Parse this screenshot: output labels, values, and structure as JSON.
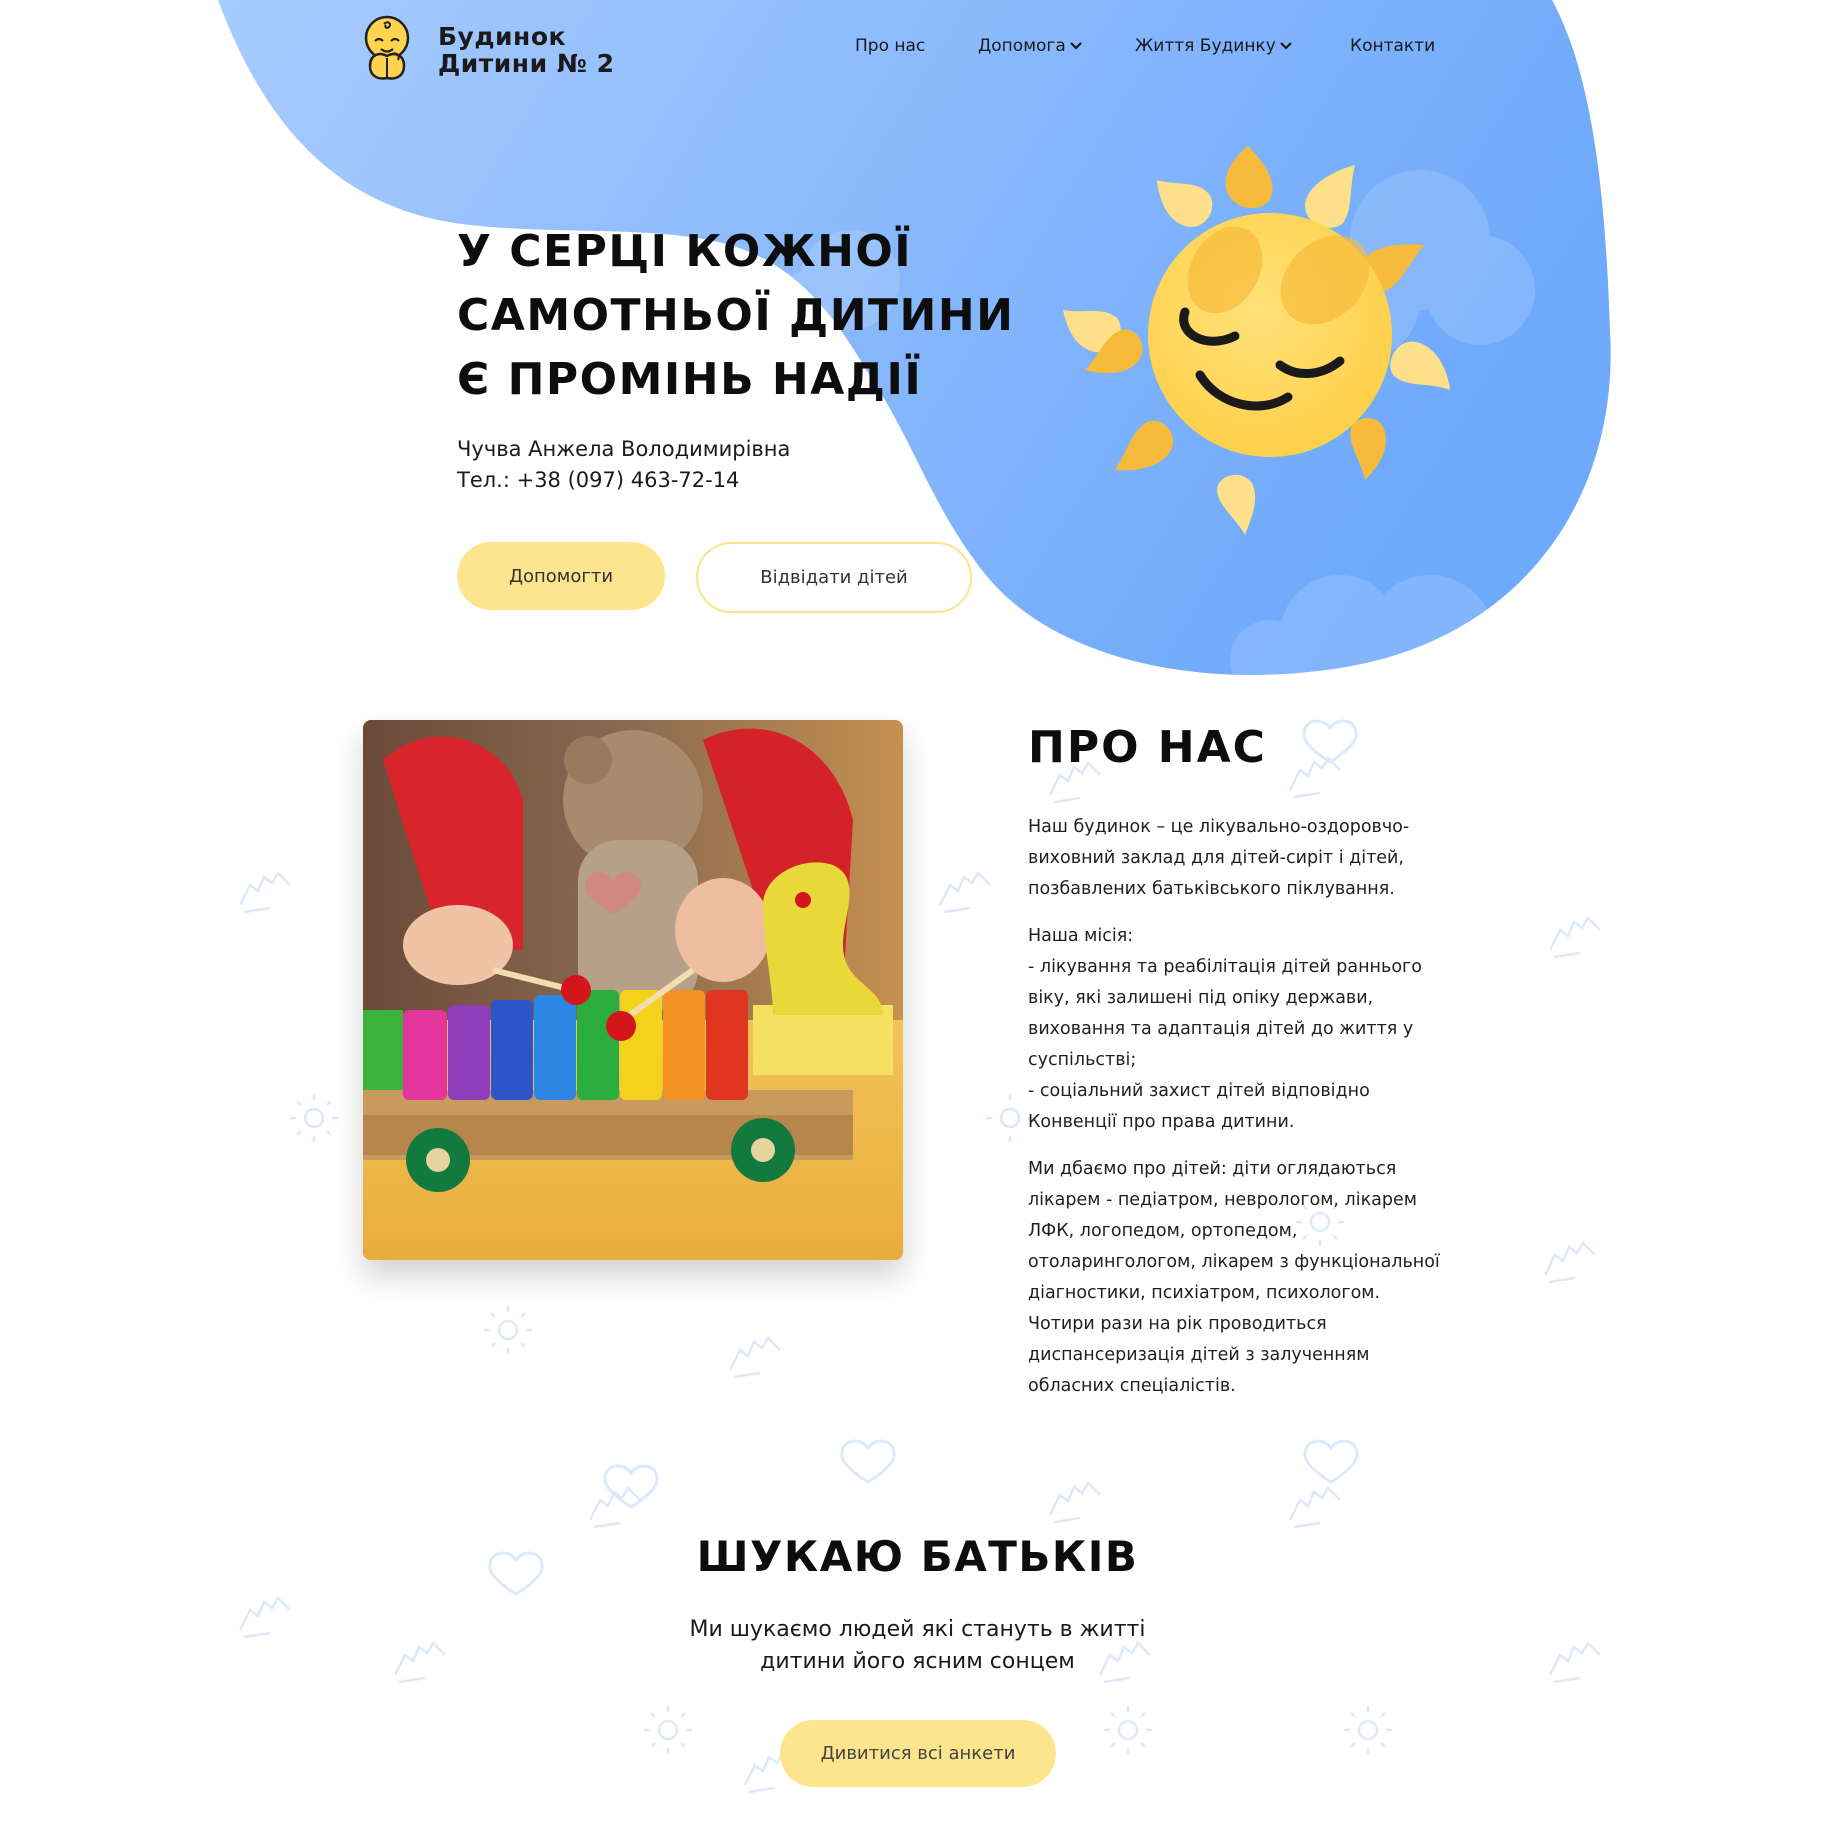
{
  "header": {
    "logo_line1": "Будинок",
    "logo_line2": "Дитини № 2",
    "nav": [
      {
        "label": "Про нас",
        "dropdown": false
      },
      {
        "label": "Допомога",
        "dropdown": true
      },
      {
        "label": "Життя Будинку",
        "dropdown": true
      },
      {
        "label": "Контакти",
        "dropdown": false
      }
    ]
  },
  "hero": {
    "title_lines": [
      "У СЕРЦІ КОЖНОЇ",
      "САМОТНЬОЇ ДИТИНИ",
      "Є ПРОМІНЬ НАДІЇ"
    ],
    "contact_name": "Чучва Анжела Володимирівна",
    "contact_phone": "Тел.: +38 (097) 463-72-14",
    "btn_help": "Допомогти",
    "btn_visit": "Відвідати дітей"
  },
  "about": {
    "title": "ПРО НАС",
    "p1": "Наш будинок – це лікувально-оздоровчо-\nвиховний заклад для дітей-сиріт і дітей,\nпозбавлених батьківського піклування.",
    "p2": "Наша місія:\n- лікування та реабілітація дітей раннього\nвіку, які залишені під опіку держави,\nвиховання та адаптація дітей до життя у\nсуспільстві;\n- соціальний захист дітей відповідно\nКонвенції про права дитини.",
    "p3": "Ми дбаємо про дітей: діти оглядаються\nлікарем - педіатром, неврологом, лікарем\nЛФК, логопедом, ортопедом,\nотоларингологом, лікарем з функціональної\nдіагностики, психіатром, психологом.\nЧотири рази на рік проводиться\nдиспансеризація дітей з залученням\nобласних спеціалістів."
  },
  "parents": {
    "title": "ШУКАЮ БАТЬКІВ",
    "sub_line1": "Ми шукаємо людей які стануть в житті",
    "sub_line2": "дитини його ясним сонцем",
    "btn_all": "Дивитися всі анкети"
  },
  "colors": {
    "blob_light": "#9cc4fd",
    "blob_dark": "#6eacfb",
    "accent_yellow": "#fde58e",
    "sun_face": "#ffd44f"
  }
}
